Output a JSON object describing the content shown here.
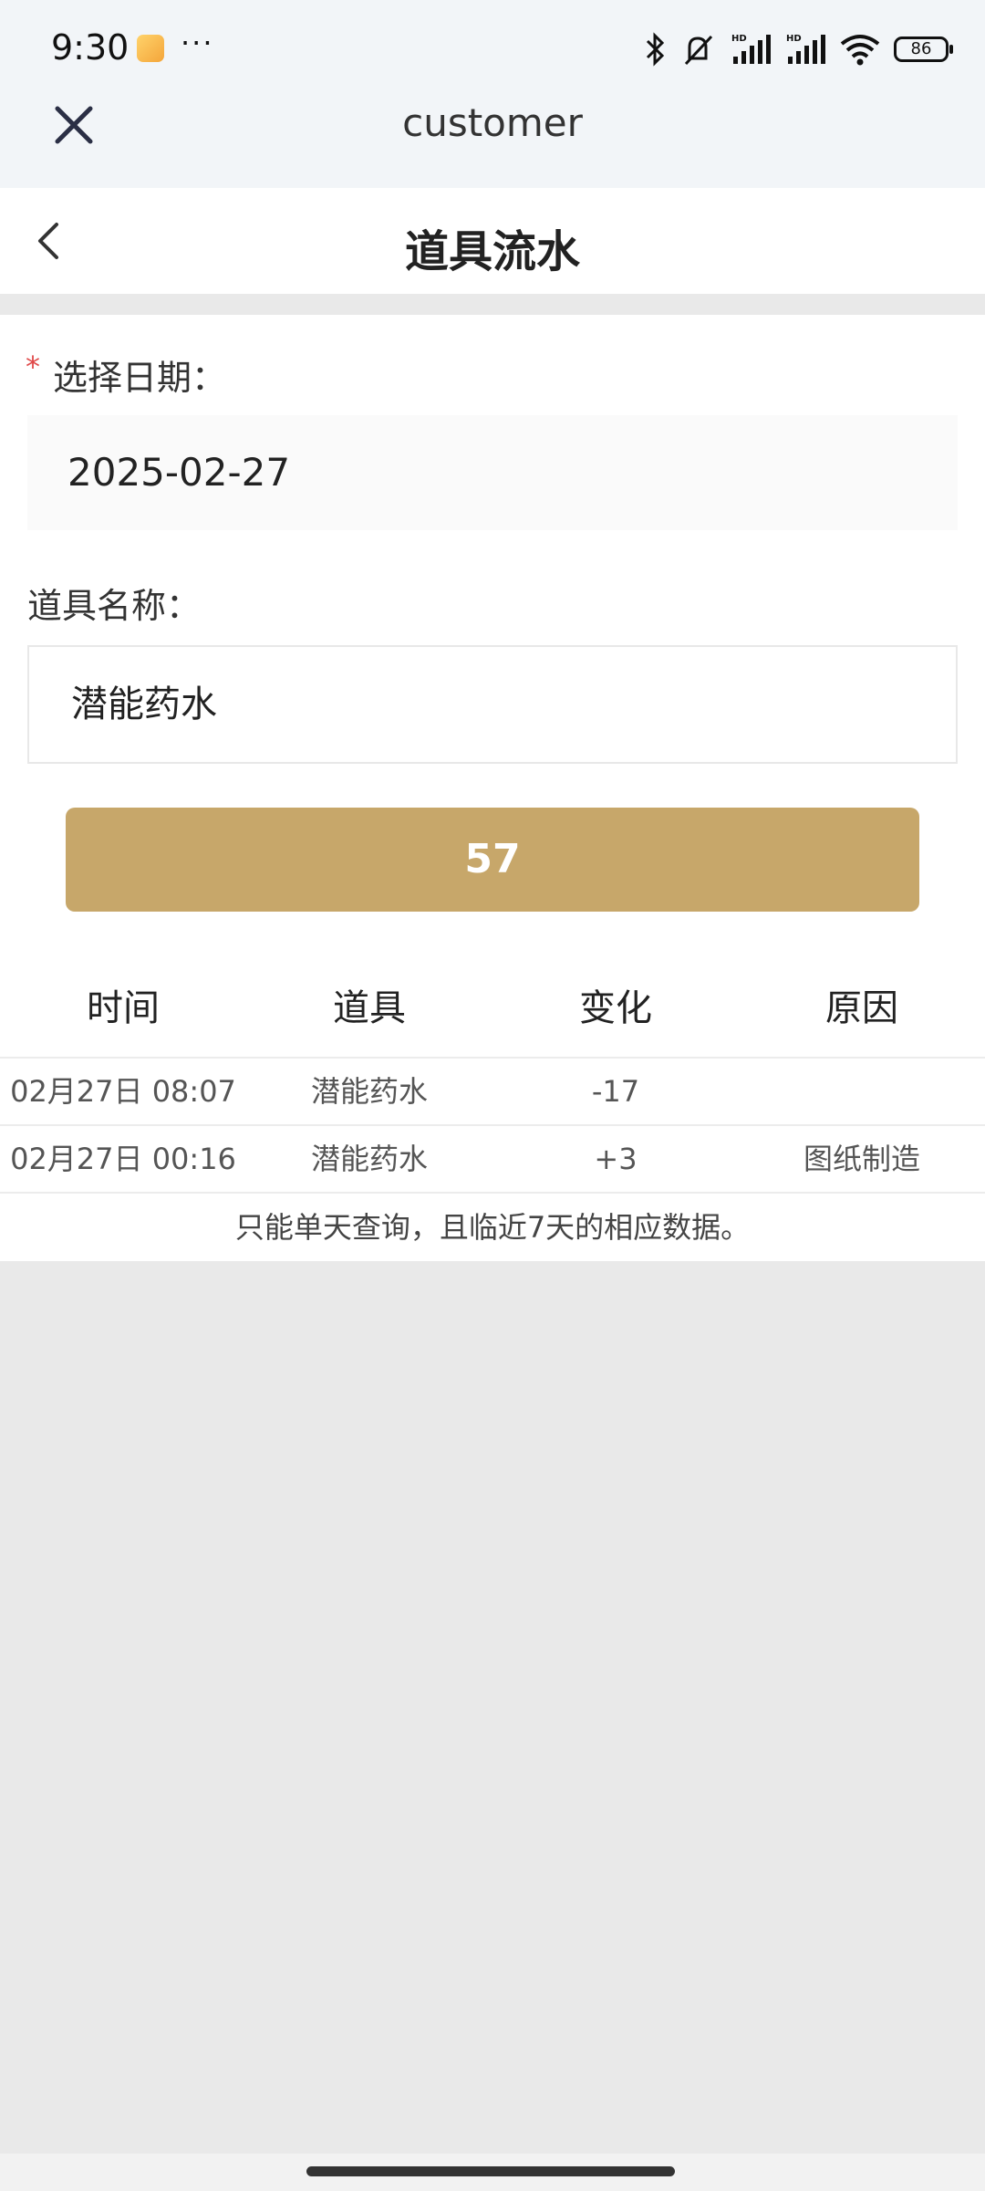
{
  "status_bar": {
    "time": "9:30",
    "more": "···",
    "battery": "86"
  },
  "appbar": {
    "title": "customer"
  },
  "header": {
    "title": "道具流水"
  },
  "form": {
    "date_required_mark": "*",
    "date_label": "选择日期：",
    "date_value": "2025-02-27",
    "item_label": "道具名称：",
    "item_value": "潜能药水",
    "button_label": "57"
  },
  "table": {
    "headers": [
      "时间",
      "道具",
      "变化",
      "原因"
    ],
    "rows": [
      [
        "02月27日 08:07",
        "潜能药水",
        "-17",
        ""
      ],
      [
        "02月27日 00:16",
        "潜能药水",
        "+3",
        "图纸制造"
      ]
    ],
    "note": "只能单天查询，且临近7天的相应数据。"
  },
  "colors": {
    "accent": "#c7a76a",
    "required": "#e04a4a"
  }
}
